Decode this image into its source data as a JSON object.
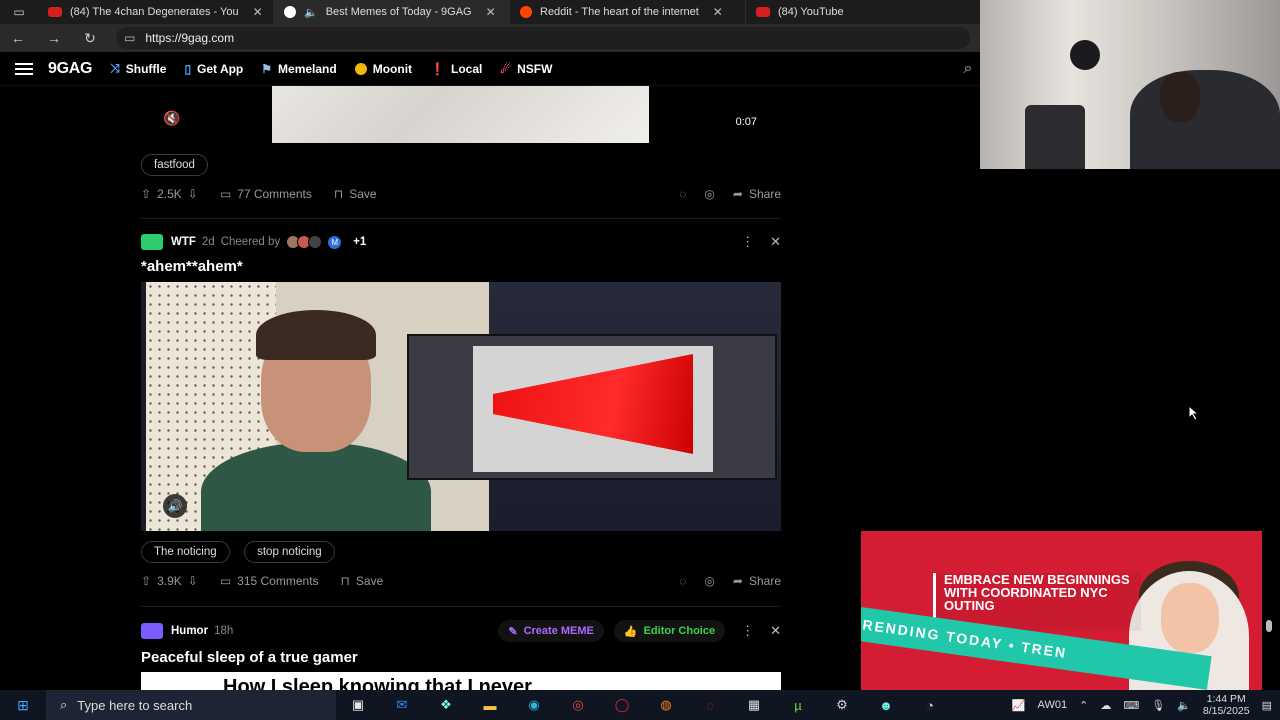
{
  "browser": {
    "tabs": [
      {
        "title": "(84) The 4chan Degenerates - You",
        "active": false
      },
      {
        "title": "Best Memes of Today - 9GAG",
        "active": true
      },
      {
        "title": "Reddit - The heart of the internet",
        "active": false
      },
      {
        "title": "(84) YouTube",
        "active": false
      }
    ],
    "url": "https://9gag.com"
  },
  "site": {
    "logo": "9GAG",
    "nav": [
      "Shuffle",
      "Get App",
      "Memeland",
      "Moonit",
      "Local",
      "NSFW"
    ]
  },
  "post1": {
    "timer": "0:07",
    "tags": [
      "fastfood"
    ],
    "upvotes": "2.5K",
    "comments": "77 Comments",
    "save": "Save",
    "share": "Share"
  },
  "post2": {
    "category": "WTF",
    "age": "2d",
    "cheered_by": "Cheered by",
    "avatar_letter": "M",
    "more": "+1",
    "title": "*ahem**ahem*",
    "tags": [
      "The noticing",
      "stop noticing"
    ],
    "upvotes": "3.9K",
    "comments": "315 Comments",
    "save": "Save",
    "share": "Share"
  },
  "post3": {
    "category": "Humor",
    "age": "18h",
    "create": "Create MEME",
    "editor": "Editor Choice",
    "title": "Peaceful sleep of a true gamer",
    "image_text": "How I sleep knowing that I never"
  },
  "ad": {
    "text": "EMBRACE NEW BEGINNINGS WITH COORDINATED NYC OUTING",
    "banner": "RENDING TODAY • TREN"
  },
  "taskbar": {
    "search_placeholder": "Type here to search",
    "user": "AW01",
    "time": "1:44 PM",
    "date": "8/15/2025"
  },
  "colors": {
    "wtf": "#2ecc71",
    "humor": "#7b5cff",
    "accent": "#ff4d6d",
    "editor": "#3ad24b"
  }
}
